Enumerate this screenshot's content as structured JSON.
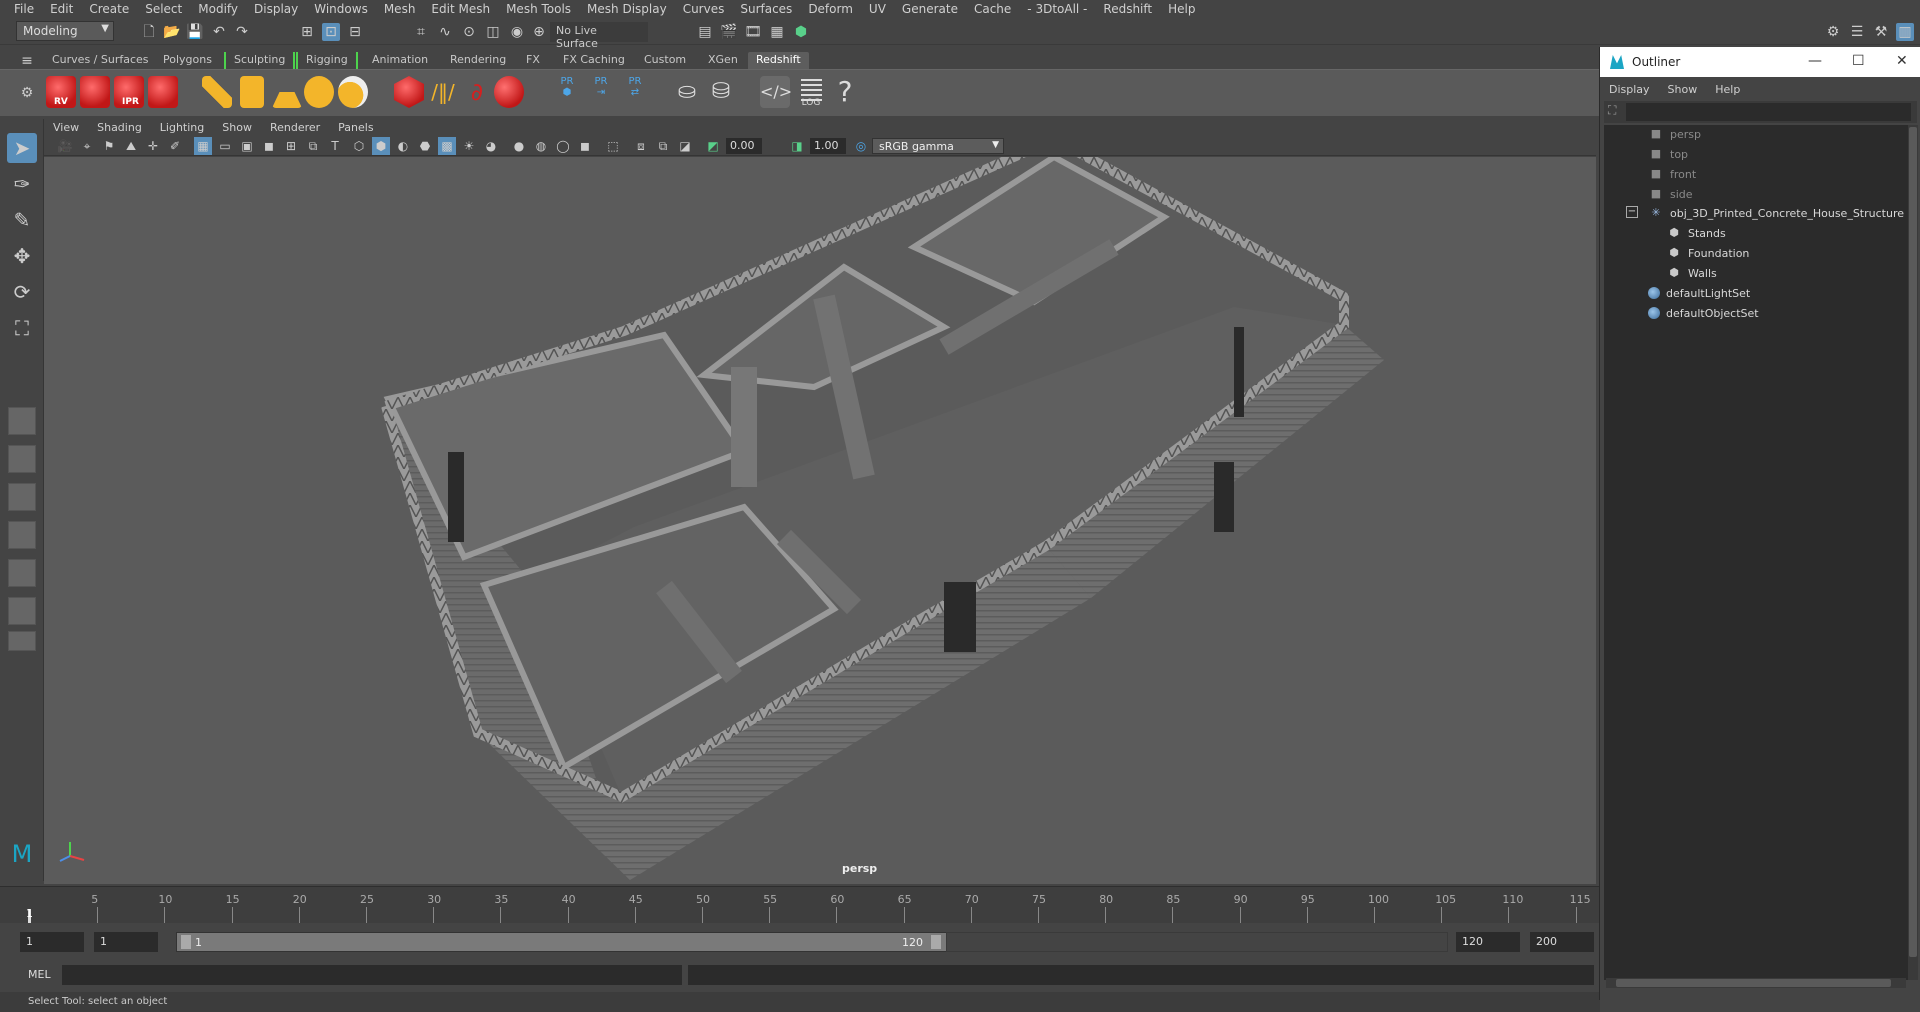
{
  "main_menu": [
    "File",
    "Edit",
    "Create",
    "Select",
    "Modify",
    "Display",
    "Windows",
    "Mesh",
    "Edit Mesh",
    "Mesh Tools",
    "Mesh Display",
    "Curves",
    "Surfaces",
    "Deform",
    "UV",
    "Generate",
    "Cache",
    "- 3DtoAll -",
    "Redshift",
    "Help"
  ],
  "status_line": {
    "mode": "Modeling",
    "live_surface": "No Live Surface"
  },
  "shelf_tabs": [
    "Curves / Surfaces",
    "Polygons",
    "Sculpting",
    "Rigging",
    "Animation",
    "Rendering",
    "FX",
    "FX Caching",
    "Custom",
    "XGen",
    "Redshift"
  ],
  "active_shelf_tab": "Redshift",
  "shelf_buttons": {
    "rv": "RV",
    "ipr": "IPR",
    "pr": "PR",
    "log": "LOG"
  },
  "viewport_menu": [
    "View",
    "Shading",
    "Lighting",
    "Show",
    "Renderer",
    "Panels"
  ],
  "panel_toolbar": {
    "exposure": "0.00",
    "gamma": "1.00",
    "color_space": "sRGB gamma"
  },
  "viewport": {
    "camera": "persp"
  },
  "timeline": {
    "ticks": [
      "5",
      "10",
      "15",
      "20",
      "25",
      "30",
      "35",
      "40",
      "45",
      "50",
      "55",
      "60",
      "65",
      "70",
      "75",
      "80",
      "85",
      "90",
      "95",
      "100",
      "105",
      "110",
      "115"
    ],
    "current_frame": "1"
  },
  "range": {
    "start_time": "1",
    "playback_start": "1",
    "slider_start": "1",
    "slider_end": "120",
    "playback_end": "120",
    "end_time": "200"
  },
  "command_line": {
    "label": "MEL"
  },
  "help_line": "Select Tool: select an object",
  "outliner": {
    "title": "Outliner",
    "menus": [
      "Display",
      "Show",
      "Help"
    ],
    "items": [
      {
        "label": "persp",
        "type": "camera"
      },
      {
        "label": "top",
        "type": "camera"
      },
      {
        "label": "front",
        "type": "camera"
      },
      {
        "label": "side",
        "type": "camera"
      },
      {
        "label": "obj_3D_Printed_Concrete_House_Structure",
        "type": "group"
      },
      {
        "label": "Stands",
        "type": "mesh"
      },
      {
        "label": "Foundation",
        "type": "mesh"
      },
      {
        "label": "Walls",
        "type": "mesh"
      },
      {
        "label": "defaultLightSet",
        "type": "set"
      },
      {
        "label": "defaultObjectSet",
        "type": "set"
      }
    ]
  },
  "colors": {
    "accent": "#5a8fba",
    "redshift_red": "#d42020",
    "shelf_bracket": "#4dd34d",
    "maya_logo": "#1ba5c4"
  }
}
